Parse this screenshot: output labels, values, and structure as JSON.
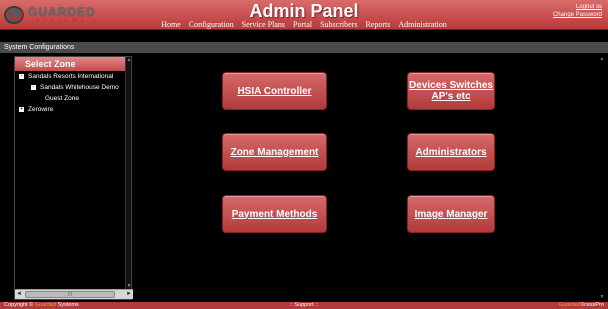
{
  "logo": {
    "word": "GUARDED",
    "sub": "SYSTEMS"
  },
  "header": {
    "title": "Admin Panel",
    "logout": "Logout ss",
    "change_password": "Change Password"
  },
  "nav": [
    "Home",
    "Configuration",
    "Service Plans",
    "Portal",
    "Subscribers",
    "Reports",
    "Administration"
  ],
  "section_title": "System Configurations",
  "sidebar": {
    "heading": "Select Zone",
    "tree": [
      {
        "label": "Sandals Resorts International",
        "toggle": "-"
      },
      {
        "label": "Sandals Whitehouse Demo",
        "toggle": "-"
      },
      {
        "label": "Guest Zone",
        "toggle": ""
      },
      {
        "label": "Zerowire",
        "toggle": "+"
      }
    ],
    "hscroll_glyph": "|||"
  },
  "tiles": {
    "hsia": "HSIA Controller",
    "devices": "Devices Switches AP's etc",
    "zone": "Zone Management",
    "admins": "Administrators",
    "payment": "Payment Methods",
    "image": "Image Manager"
  },
  "footer": {
    "copyright_prefix": "Copyright ©",
    "brand": "Guarded",
    "copyright_suffix": "Systems",
    "support": ":: Support ::",
    "right_brand": "Guarded",
    "right_suffix": "XcessPro"
  },
  "colors": {
    "brand_red": "#b83a3a",
    "accent_orange": "#ff9a3a"
  }
}
